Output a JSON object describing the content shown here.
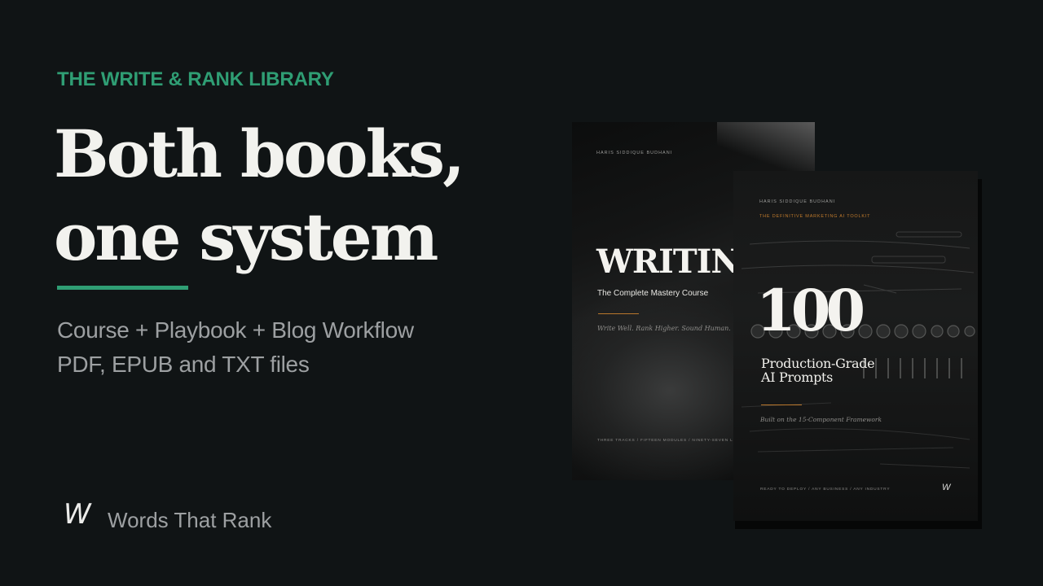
{
  "hero": {
    "eyebrow": "THE WRITE & RANK LIBRARY",
    "headline_line1": "Both books,",
    "headline_line2": "one system",
    "subline1": "Course + Playbook + Blog Workflow",
    "subline2": "PDF, EPUB and TXT files"
  },
  "brand": {
    "logo_mark": "W",
    "name": "Words That Rank"
  },
  "books": [
    {
      "author": "HARIS SIDDIQUE BUDHANI",
      "title": "WRITING",
      "subtitle": "The Complete Mastery Course",
      "tagline": "Write Well. Rank Higher. Sound Human.",
      "footer": "THREE TRACKS  /  FIFTEEN MODULES  /  NINETY-SEVEN LESSONS"
    },
    {
      "author": "HARIS SIDDIQUE BUDHANI",
      "kicker": "THE DEFINITIVE MARKETING AI TOOLKIT",
      "number": "100",
      "title_line1": "Production-Grade",
      "title_line2": "AI Prompts",
      "tagline": "Built on the 15-Component Framework",
      "footer": "READY TO DEPLOY  /  ANY BUSINESS  /  ANY INDUSTRY",
      "logo_mark": "W"
    }
  ],
  "colors": {
    "background": "#101415",
    "accent": "#2f9e74",
    "gold": "#b9772c"
  }
}
